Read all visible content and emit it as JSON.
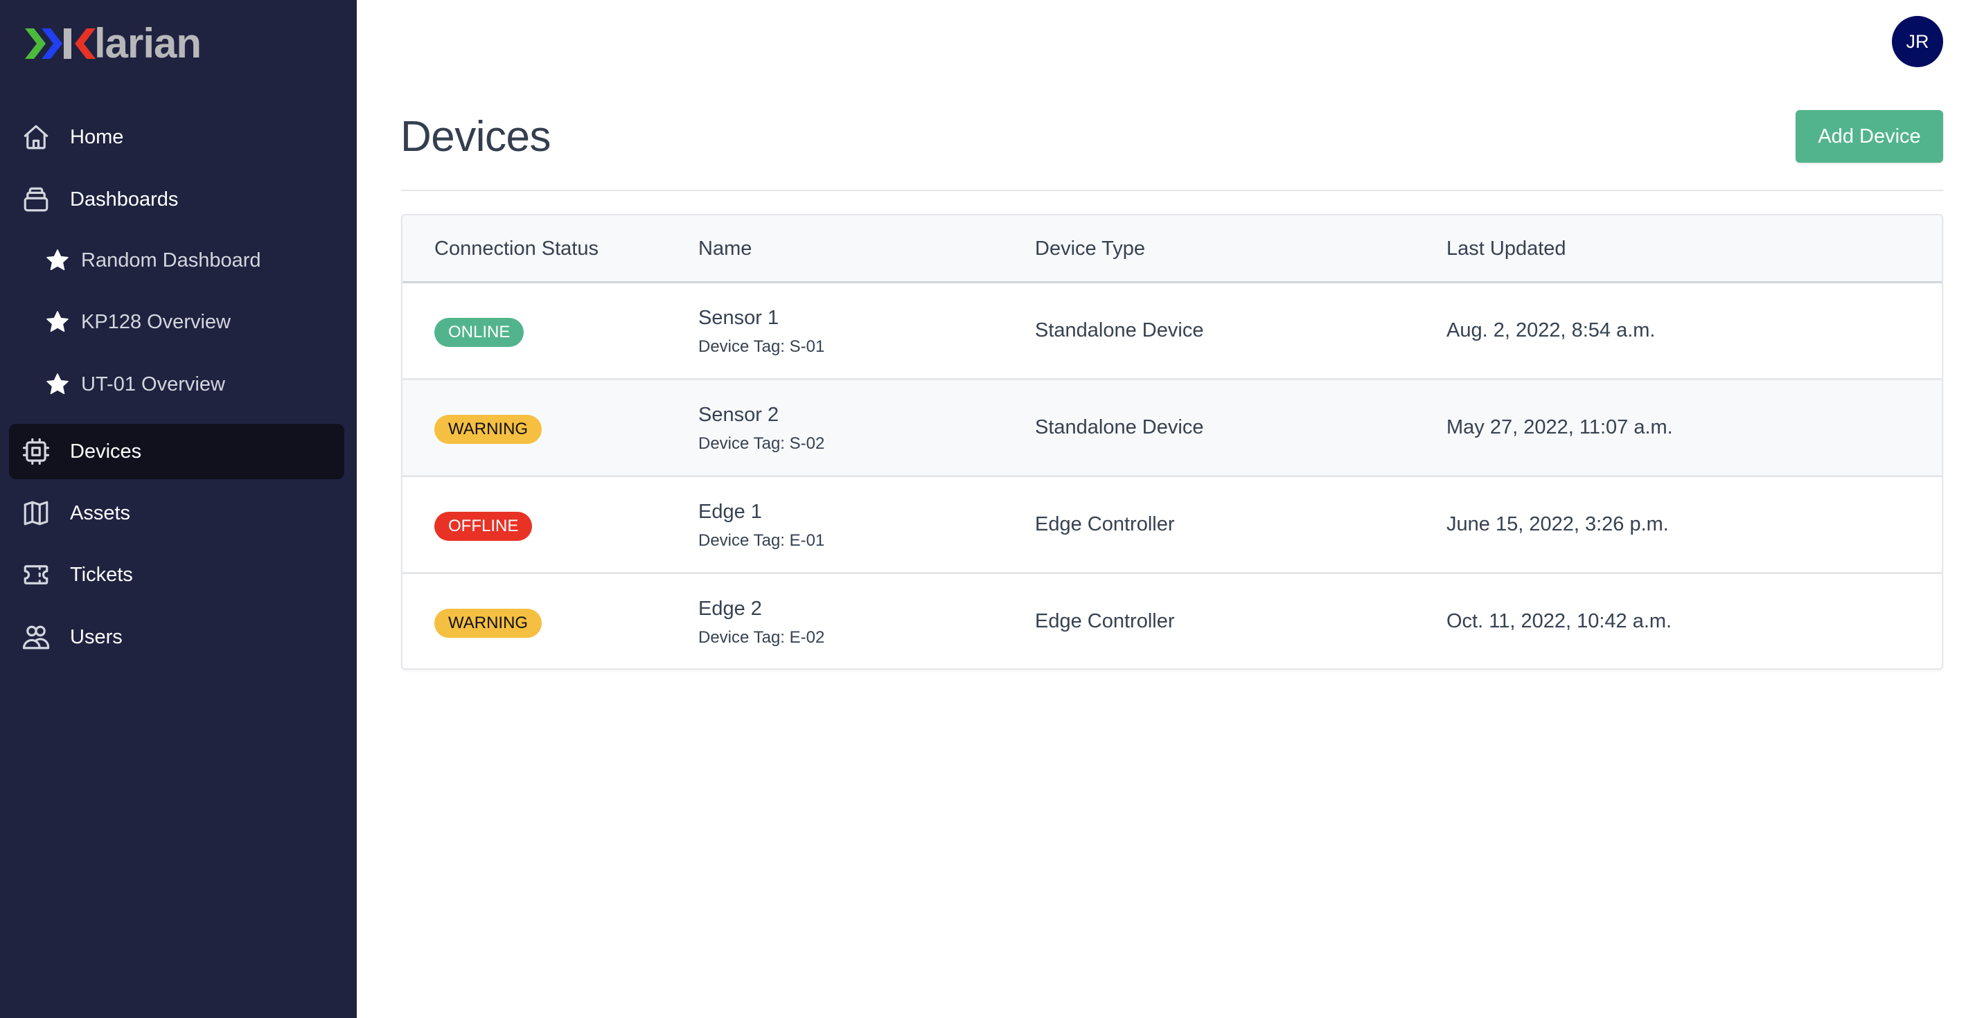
{
  "app": {
    "brand": "Klarian",
    "brand_colors": {
      "chevron1": "#4cbb3d",
      "chevron2": "#1f3ff0",
      "k": "#e83226",
      "text": "#b8b8bb"
    }
  },
  "sidebar": {
    "items": [
      {
        "label": "Home",
        "icon": "home-icon"
      },
      {
        "label": "Dashboards",
        "icon": "dashboards-icon"
      },
      {
        "label": "Random Dashboard",
        "icon": "star-icon",
        "sub": true
      },
      {
        "label": "KP128 Overview",
        "icon": "star-icon",
        "sub": true
      },
      {
        "label": "UT-01 Overview",
        "icon": "star-icon",
        "sub": true
      },
      {
        "label": "Devices",
        "icon": "chip-icon",
        "active": true
      },
      {
        "label": "Assets",
        "icon": "map-icon"
      },
      {
        "label": "Tickets",
        "icon": "ticket-icon"
      },
      {
        "label": "Users",
        "icon": "users-icon"
      }
    ]
  },
  "header": {
    "avatar_initials": "JR",
    "avatar_color": "#020c61"
  },
  "page": {
    "title": "Devices",
    "add_button_label": "Add Device",
    "accent_color": "#52b48c"
  },
  "table": {
    "columns": [
      "Connection Status",
      "Name",
      "Device Type",
      "Last Updated"
    ],
    "rows": [
      {
        "status": "ONLINE",
        "status_kind": "online",
        "name": "Sensor 1",
        "tag": "Device Tag: S-01",
        "type": "Standalone Device",
        "updated": "Aug. 2, 2022, 8:54 a.m."
      },
      {
        "status": "WARNING",
        "status_kind": "warning",
        "name": "Sensor 2",
        "tag": "Device Tag: S-02",
        "type": "Standalone Device",
        "updated": "May 27, 2022, 11:07 a.m."
      },
      {
        "status": "OFFLINE",
        "status_kind": "offline",
        "name": "Edge 1",
        "tag": "Device Tag: E-01",
        "type": "Edge Controller",
        "updated": "June 15, 2022, 3:26 p.m."
      },
      {
        "status": "WARNING",
        "status_kind": "warning",
        "name": "Edge 2",
        "tag": "Device Tag: E-02",
        "type": "Edge Controller",
        "updated": "Oct. 11, 2022, 10:42 a.m."
      }
    ],
    "status_colors": {
      "online": "#52b48c",
      "warning": "#f5bf41",
      "offline": "#e83226"
    }
  }
}
